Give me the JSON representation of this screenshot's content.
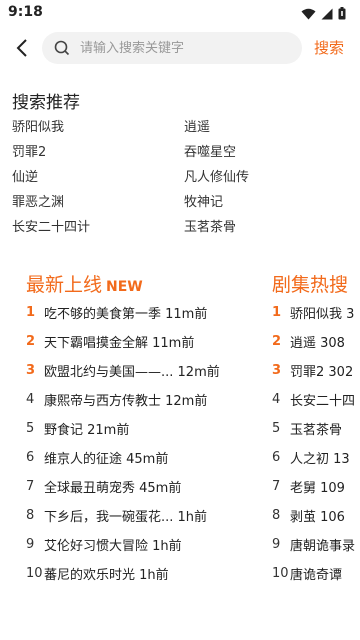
{
  "status": {
    "time": "9:18"
  },
  "search": {
    "placeholder": "请输入搜索关键字",
    "button_label": "搜索"
  },
  "recommend": {
    "title": "搜索推荐",
    "items": [
      "骄阳似我",
      "逍遥",
      "罚罪2",
      "吞噬星空",
      "仙逆",
      "凡人修仙传",
      "罪恶之渊",
      "牧神记",
      "长安二十四计",
      "玉茗茶骨"
    ]
  },
  "latest": {
    "title": "最新上线",
    "badge": "NEW",
    "rows": [
      {
        "rank": "1",
        "text": "吃不够的美食第一季 11m前"
      },
      {
        "rank": "2",
        "text": "天下霸唱摸金全解 11m前"
      },
      {
        "rank": "3",
        "text": "欧盟北约与美国——... 12m前"
      },
      {
        "rank": "4",
        "text": "康熙帝与西方传教士 12m前"
      },
      {
        "rank": "5",
        "text": "野食记 21m前"
      },
      {
        "rank": "6",
        "text": "维京人的征途 45m前"
      },
      {
        "rank": "7",
        "text": "全球最丑萌宠秀 45m前"
      },
      {
        "rank": "8",
        "text": "下乡后，我一碗蛋花... 1h前"
      },
      {
        "rank": "9",
        "text": "艾伦好习惯大冒险 1h前"
      },
      {
        "rank": "10",
        "text": "蕃尼的欢乐时光 1h前"
      }
    ]
  },
  "hot": {
    "title": "剧集热搜",
    "rows": [
      {
        "rank": "1",
        "text": "骄阳似我 3"
      },
      {
        "rank": "2",
        "text": "逍遥 308"
      },
      {
        "rank": "3",
        "text": "罚罪2 302"
      },
      {
        "rank": "4",
        "text": "长安二十四"
      },
      {
        "rank": "5",
        "text": "玉茗茶骨"
      },
      {
        "rank": "6",
        "text": "人之初 13"
      },
      {
        "rank": "7",
        "text": "老舅 109"
      },
      {
        "rank": "8",
        "text": "剥茧 106"
      },
      {
        "rank": "9",
        "text": "唐朝诡事录"
      },
      {
        "rank": "10",
        "text": "唐诡奇谭"
      }
    ]
  },
  "colors": {
    "accent": "#f26a1b"
  }
}
